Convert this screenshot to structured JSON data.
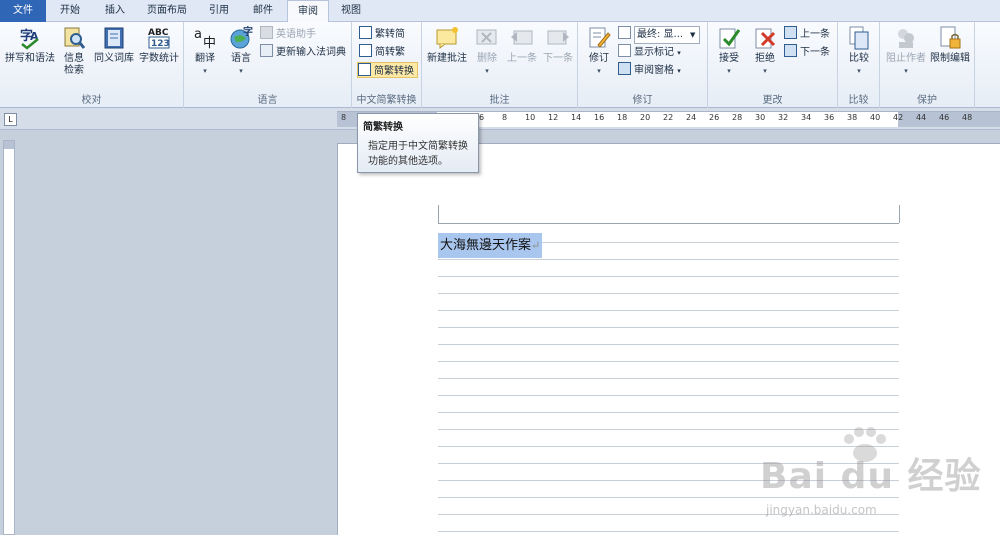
{
  "tabs": [
    {
      "label": "文件"
    },
    {
      "label": "开始"
    },
    {
      "label": "插入"
    },
    {
      "label": "页面布局"
    },
    {
      "label": "引用"
    },
    {
      "label": "邮件"
    },
    {
      "label": "审阅"
    },
    {
      "label": "视图"
    }
  ],
  "ribbon": {
    "proofing": {
      "group_label": "校对",
      "spelling": "拼写和语法",
      "research_line1": "信息",
      "research_line2": "检索",
      "thesaurus": "同义词库",
      "word_count": "字数统计"
    },
    "language": {
      "group_label": "语言",
      "translate": "翻译",
      "language": "语言",
      "english_assistant": "英语助手",
      "update_ime": "更新输入法词典"
    },
    "chinese_conversion": {
      "group_label": "中文简繁转换",
      "to_simplified": "繁转简",
      "to_traditional": "简转繁",
      "conversion": "简繁转换"
    },
    "comments": {
      "group_label": "批注",
      "new_comment": "新建批注",
      "delete": "删除",
      "previous": "上一条",
      "next": "下一条"
    },
    "tracking": {
      "group_label": "修订",
      "track_changes": "修订",
      "final_dropdown": "最终: 显...",
      "show_markup": "显示标记",
      "reviewing_pane": "审阅窗格"
    },
    "changes": {
      "group_label": "更改",
      "accept": "接受",
      "reject": "拒绝",
      "previous": "上一条",
      "next": "下一条"
    },
    "compare": {
      "group_label": "比较",
      "compare": "比较"
    },
    "protect": {
      "group_label": "保护",
      "block_authors": "阻止作者",
      "restrict_editing": "限制编辑"
    }
  },
  "ruler": {
    "corner_glyph": "L",
    "numbers": [
      "8",
      "6",
      "4",
      "2",
      "2",
      "4",
      "6",
      "8",
      "10",
      "12",
      "14",
      "16",
      "18",
      "20",
      "22",
      "24",
      "26",
      "28",
      "30",
      "32",
      "34",
      "36",
      "38",
      "40",
      "42",
      "44",
      "46",
      "48"
    ]
  },
  "tooltip": {
    "title": "简繁转换",
    "body": "指定用于中文简繁转换功能的其他选项。"
  },
  "document": {
    "selected_text": "大海無邊天作案",
    "paragraph_mark": "↵"
  },
  "watermark": {
    "logo": "Bai du 经验",
    "url": "jingyan.baidu.com"
  },
  "colors": {
    "file_tab": "#2f66b5",
    "selection": "#a9c7ee",
    "highlight": "#fde9a6"
  }
}
